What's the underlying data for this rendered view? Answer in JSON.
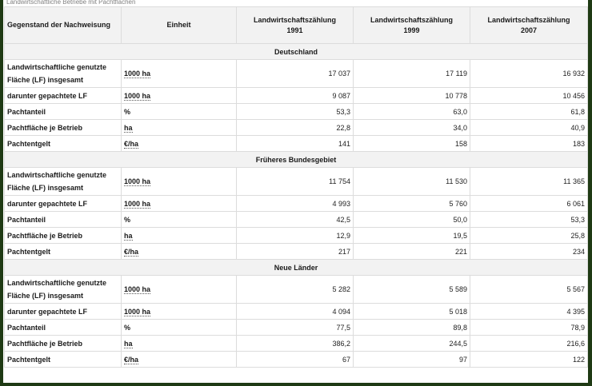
{
  "caption": "Landwirtschaftliche Betriebe mit Pachtflächen",
  "header": {
    "label_col": "Gegenstand der Nachweisung",
    "unit_col": "Einheit",
    "years": [
      {
        "line1": "Landwirtschaftszählung",
        "line2": "1991"
      },
      {
        "line1": "Landwirtschaftszählung",
        "line2": "1999"
      },
      {
        "line1": "Landwirtschaftszählung",
        "line2": "2007"
      }
    ]
  },
  "sections": [
    {
      "title": "Deutschland",
      "rows": [
        {
          "label": "Landwirtschaftliche genutzte Fläche (LF) insgesamt",
          "unit": "1000 ha",
          "values": [
            "17 037",
            "17 119",
            "16 932"
          ]
        },
        {
          "label": "darunter gepachtete LF",
          "unit": "1000 ha",
          "values": [
            "9 087",
            "10 778",
            "10 456"
          ]
        },
        {
          "label": "Pachtanteil",
          "unit": "%",
          "values": [
            "53,3",
            "63,0",
            "61,8"
          ]
        },
        {
          "label": "Pachtfläche je Betrieb",
          "unit": "ha",
          "values": [
            "22,8",
            "34,0",
            "40,9"
          ]
        },
        {
          "label": "Pachtentgelt",
          "unit": "€/ha",
          "values": [
            "141",
            "158",
            "183"
          ]
        }
      ]
    },
    {
      "title": "Früheres Bundesgebiet",
      "rows": [
        {
          "label": "Landwirtschaftliche genutzte Fläche (LF) insgesamt",
          "unit": "1000 ha",
          "values": [
            "11 754",
            "11 530",
            "11 365"
          ]
        },
        {
          "label": "darunter gepachtete LF",
          "unit": "1000 ha",
          "values": [
            "4 993",
            "5 760",
            "6 061"
          ]
        },
        {
          "label": "Pachtanteil",
          "unit": "%",
          "values": [
            "42,5",
            "50,0",
            "53,3"
          ]
        },
        {
          "label": "Pachtfläche je Betrieb",
          "unit": "ha",
          "values": [
            "12,9",
            "19,5",
            "25,8"
          ]
        },
        {
          "label": "Pachtentgelt",
          "unit": "€/ha",
          "values": [
            "217",
            "221",
            "234"
          ]
        }
      ]
    },
    {
      "title": "Neue Länder",
      "rows": [
        {
          "label": "Landwirtschaftliche genutzte Fläche (LF) insgesamt",
          "unit": "1000 ha",
          "values": [
            "5 282",
            "5 589",
            "5 567"
          ]
        },
        {
          "label": "darunter gepachtete LF",
          "unit": "1000 ha",
          "values": [
            "4 094",
            "5 018",
            "4 395"
          ]
        },
        {
          "label": "Pachtanteil",
          "unit": "%",
          "values": [
            "77,5",
            "89,8",
            "78,9"
          ]
        },
        {
          "label": "Pachtfläche je Betrieb",
          "unit": "ha",
          "values": [
            "386,2",
            "244,5",
            "216,6"
          ]
        },
        {
          "label": "Pachtentgelt",
          "unit": "€/ha",
          "values": [
            "67",
            "97",
            "122"
          ]
        }
      ]
    }
  ]
}
